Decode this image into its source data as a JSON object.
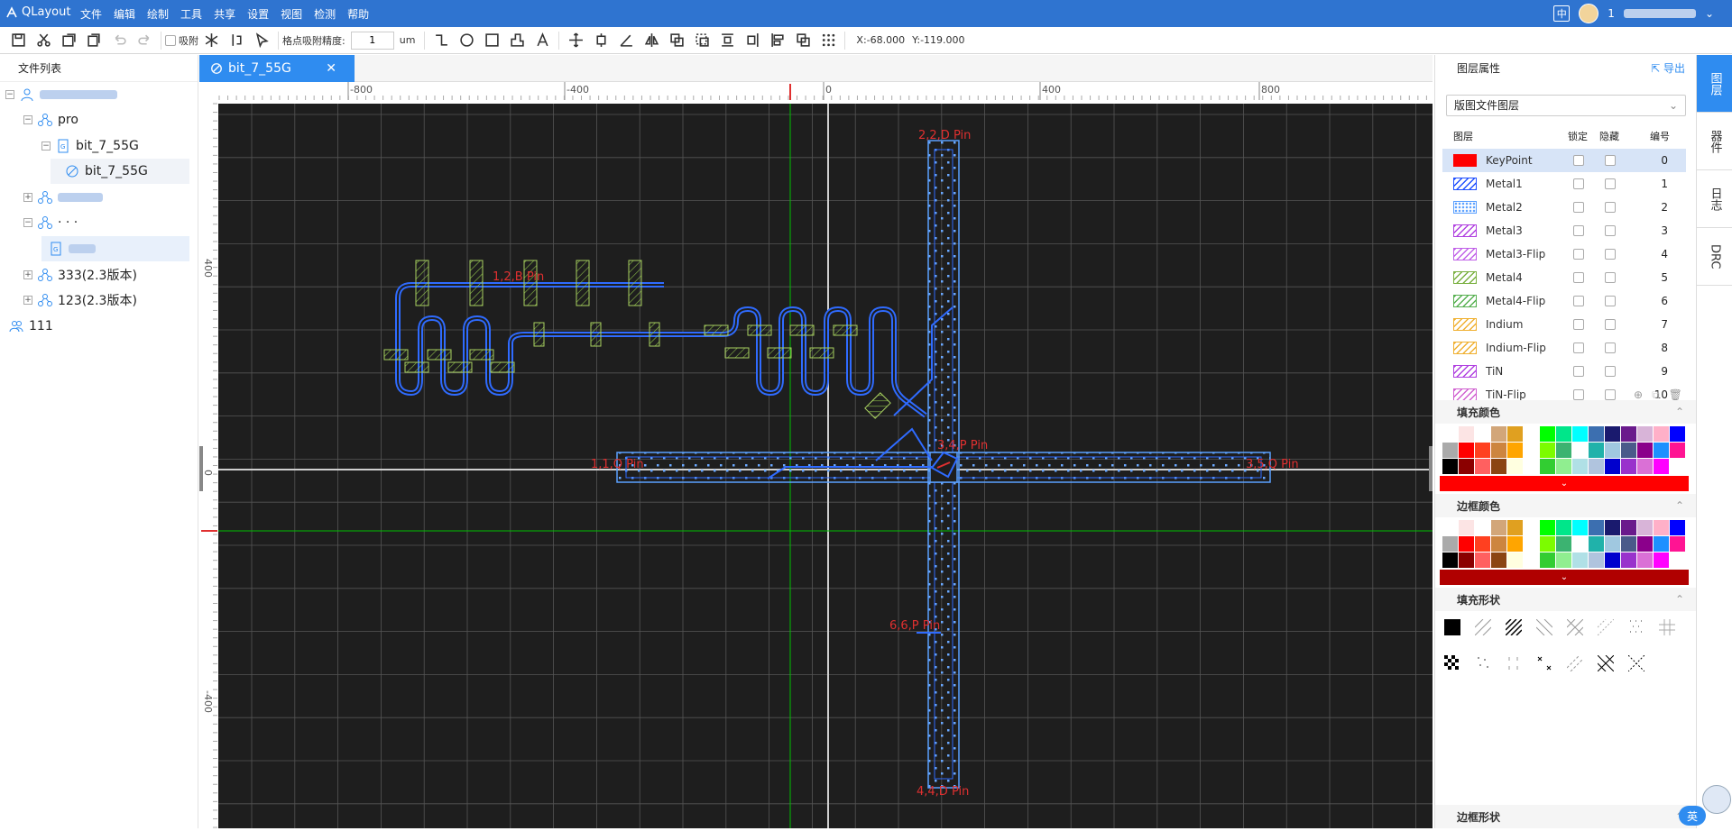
{
  "app": {
    "title": "QLayout"
  },
  "menu": [
    "文件",
    "编辑",
    "绘制",
    "工具",
    "共享",
    "设置",
    "视图",
    "检测",
    "帮助"
  ],
  "header": {
    "ime": "中",
    "user": "1"
  },
  "toolbar": {
    "snap_label": "吸附",
    "precision_label": "格点吸附精度:",
    "precision_value": "1",
    "unit": "um",
    "coord_x": "X:-68.000",
    "coord_y": "Y:-119.000"
  },
  "sidebar": {
    "title": "文件列表",
    "items": [
      {
        "label": "",
        "type": "user"
      },
      {
        "label": "pro",
        "type": "project"
      },
      {
        "label": "bit_7_55G",
        "type": "file"
      },
      {
        "label": "bit_7_55G",
        "type": "cell"
      },
      {
        "label": "",
        "type": "project"
      },
      {
        "label": "· · ·",
        "type": "project"
      },
      {
        "label": "",
        "type": "file"
      },
      {
        "label": "333(2.3版本)",
        "type": "project"
      },
      {
        "label": "123(2.3版本)",
        "type": "project"
      },
      {
        "label": "111",
        "type": "group"
      }
    ]
  },
  "editor": {
    "tab_label": "bit_7_55G",
    "tab_close": "✕"
  },
  "ruler": {
    "x_ticks": [
      "-800",
      "-400",
      "0",
      "400",
      "800"
    ],
    "y_ticks": [
      "400",
      "0",
      "-400"
    ]
  },
  "canvas": {
    "pins": [
      "2,2,D Pin",
      "1,2,B Pin",
      "1,1,Q Pin",
      "3,4,P Pin",
      "3,5,Q Pin",
      "6,6,P Pin",
      "4,4,D Pin"
    ]
  },
  "panel": {
    "title": "图层属性",
    "export_label": "导出",
    "select_value": "版图文件图层",
    "col_layer": "图层",
    "col_lock": "锁定",
    "col_hide": "隐藏",
    "col_num": "编号",
    "layers": [
      {
        "name": "KeyPoint",
        "num": "0",
        "color": "#ff0000",
        "fill": "solid"
      },
      {
        "name": "Metal1",
        "num": "1",
        "color": "#1f4fff",
        "fill": "hatch"
      },
      {
        "name": "Metal2",
        "num": "2",
        "color": "#5aa0ff",
        "fill": "dots"
      },
      {
        "name": "Metal3",
        "num": "3",
        "color": "#b040e0",
        "fill": "hatch"
      },
      {
        "name": "Metal3-Flip",
        "num": "4",
        "color": "#c060e8",
        "fill": "hatch"
      },
      {
        "name": "Metal4",
        "num": "5",
        "color": "#7ab040",
        "fill": "hatch"
      },
      {
        "name": "Metal4-Flip",
        "num": "6",
        "color": "#56b050",
        "fill": "hatch"
      },
      {
        "name": "Indium",
        "num": "7",
        "color": "#f0b030",
        "fill": "hatch"
      },
      {
        "name": "Indium-Flip",
        "num": "8",
        "color": "#f0b030",
        "fill": "hatch"
      },
      {
        "name": "TiN",
        "num": "9",
        "color": "#b040e0",
        "fill": "hatch"
      },
      {
        "name": "TiN-Flip",
        "num": "10",
        "color": "#d060d0",
        "fill": "hatch"
      }
    ],
    "sections": {
      "fill_color": "填充颜色",
      "border_color": "边框颜色",
      "fill_shape": "填充形状",
      "border_shape": "边框形状"
    },
    "fill_bar_color": "#ff0000",
    "border_bar_color": "#b00000"
  },
  "right_tabs": [
    "图层",
    "器件",
    "日志",
    "DRC"
  ],
  "ime_badge": "英",
  "palette": [
    "#ffffff",
    "#fce4e4",
    "#ffffff",
    "#d2a679",
    "#e0a020",
    "#ffffff",
    "#00ff00",
    "#00e68a",
    "#00ffff",
    "#3c6fb0",
    "#1a1a6e",
    "#6a1a8c",
    "#d8b4d8",
    "#ffb0c8",
    "#0000ff",
    "#aaaaaa",
    "#ff0000",
    "#ff4020",
    "#cd853f",
    "#ffa500",
    "#ffffff",
    "#7cfc00",
    "#3cb371",
    "#ffffff",
    "#20b2aa",
    "#a0c8e0",
    "#4a5a8a",
    "#8b008b",
    "#1e90ff",
    "#ff1493",
    "#000000",
    "#8b0000",
    "#ff6060",
    "#8b4513",
    "#ffffe0",
    "#ffffff",
    "#32cd32",
    "#90ee90",
    "#b0e0e6",
    "#b0c4de",
    "#0000cd",
    "#9932cc",
    "#da70d6",
    "#ff00ff",
    "#ffffff"
  ]
}
